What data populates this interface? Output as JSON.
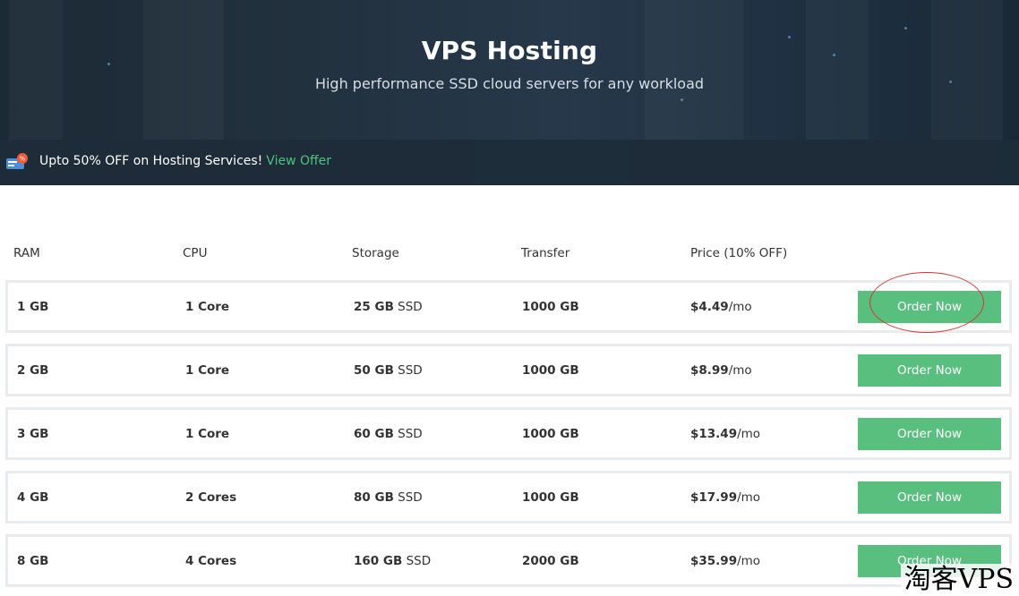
{
  "hero": {
    "title": "VPS Hosting",
    "subtitle": "High performance SSD cloud servers for any workload"
  },
  "offer": {
    "icon": "coupon-icon",
    "text": "Upto 50% OFF on Hosting Services!",
    "link": "View Offer"
  },
  "table": {
    "headers": [
      "RAM",
      "CPU",
      "Storage",
      "Transfer",
      "Price (10% OFF)"
    ],
    "rows": [
      {
        "ram": "1 GB",
        "cpu": "1 Core",
        "storage_size": "25 GB",
        "storage_type": "SSD",
        "transfer": "1000 GB",
        "price": "$4.49",
        "period": "/mo",
        "button": "Order Now"
      },
      {
        "ram": "2 GB",
        "cpu": "1 Core",
        "storage_size": "50 GB",
        "storage_type": "SSD",
        "transfer": "1000 GB",
        "price": "$8.99",
        "period": "/mo",
        "button": "Order Now"
      },
      {
        "ram": "3 GB",
        "cpu": "1 Core",
        "storage_size": "60 GB",
        "storage_type": "SSD",
        "transfer": "1000 GB",
        "price": "$13.49",
        "period": "/mo",
        "button": "Order Now"
      },
      {
        "ram": "4 GB",
        "cpu": "2 Cores",
        "storage_size": "80 GB",
        "storage_type": "SSD",
        "transfer": "1000 GB",
        "price": "$17.99",
        "period": "/mo",
        "button": "Order Now"
      },
      {
        "ram": "8 GB",
        "cpu": "4 Cores",
        "storage_size": "160 GB",
        "storage_type": "SSD",
        "transfer": "2000 GB",
        "price": "$35.99",
        "period": "/mo",
        "button": "Order Now"
      }
    ]
  },
  "watermark": "淘客VPS",
  "colors": {
    "accent": "#59bf7f",
    "link": "#4cc47f",
    "hero_bg": "#22313e",
    "annotation": "#d9362f"
  }
}
